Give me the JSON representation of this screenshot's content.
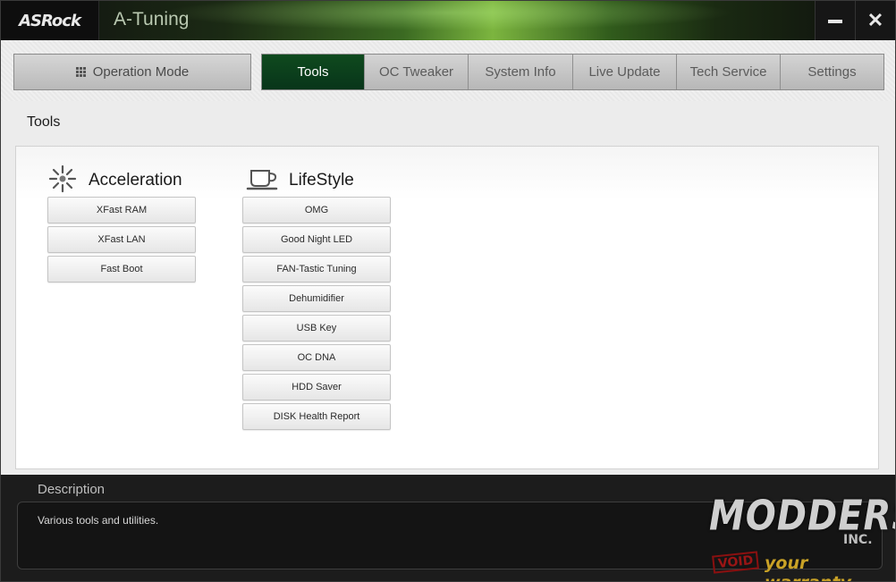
{
  "titlebar": {
    "logo": "ASRock",
    "app_title": "A-Tuning",
    "minimize_icon": "minimize-icon",
    "close_icon": "close-icon",
    "close_glyph": "✕"
  },
  "nav": {
    "operation_mode": "Operation Mode",
    "tabs": [
      {
        "label": "Tools",
        "active": true
      },
      {
        "label": "OC Tweaker"
      },
      {
        "label": "System Info"
      },
      {
        "label": "Live Update"
      },
      {
        "label": "Tech Service"
      },
      {
        "label": "Settings"
      }
    ]
  },
  "main": {
    "title": "Tools",
    "acceleration": {
      "heading": "Acceleration",
      "icon": "acceleration-icon",
      "buttons": [
        "XFast RAM",
        "XFast LAN",
        "Fast Boot"
      ]
    },
    "lifestyle": {
      "heading": "LifeStyle",
      "icon": "cup-icon",
      "buttons": [
        "OMG",
        "Good Night LED",
        "FAN-Tastic Tuning",
        "Dehumidifier",
        "USB Key",
        "OC DNA",
        "HDD Saver",
        "DISK Health Report"
      ]
    }
  },
  "description": {
    "title": "Description",
    "text": "Various tools and utilities."
  },
  "watermark": {
    "brand": "MODDERS",
    "inc": "INC.",
    "void": "VOID",
    "tagline": "your warranty"
  },
  "colors": {
    "active_tab": "#0f4a1e",
    "accent_green": "#7cb53f"
  }
}
